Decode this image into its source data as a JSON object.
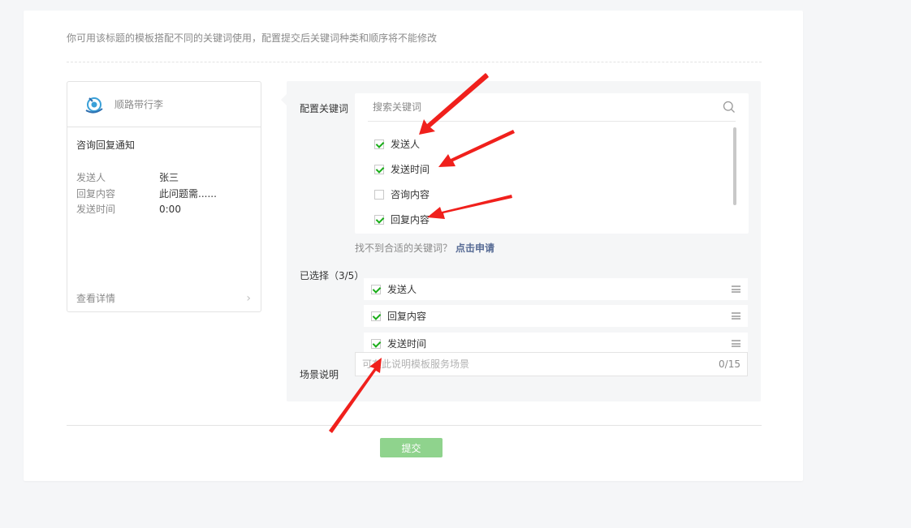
{
  "header": {
    "tip": "你可用该标题的模板搭配不同的关键词使用，配置提交后关键词种类和顺序将不能修改"
  },
  "preview": {
    "account_name": "顺路带行李",
    "title": "咨询回复通知",
    "rows": [
      {
        "key": "发送人",
        "value": "张三"
      },
      {
        "key": "回复内容",
        "value": "此问题需......"
      },
      {
        "key": "发送时间",
        "value": "0:00"
      }
    ],
    "detail_link": "查看详情"
  },
  "config": {
    "label": "配置关键词",
    "search_placeholder": "搜索关键词",
    "keywords": [
      {
        "label": "发送人",
        "checked": true
      },
      {
        "label": "发送时间",
        "checked": true
      },
      {
        "label": "咨询内容",
        "checked": false
      },
      {
        "label": "回复内容",
        "checked": true
      }
    ],
    "not_found_text": "找不到合适的关键词？",
    "apply_link": "点击申请"
  },
  "selected": {
    "label": "已选择（3/5）",
    "items": [
      "发送人",
      "回复内容",
      "发送时间"
    ]
  },
  "scene": {
    "label": "场景说明",
    "placeholder": "可在此说明模板服务场景",
    "counter": "0/15"
  },
  "actions": {
    "submit_label": "提交"
  },
  "colors": {
    "check_green": "#1aad19",
    "submit_disabled_green": "#8fd38d",
    "link_blue": "#576b95",
    "annotation_red": "#f0201c"
  }
}
